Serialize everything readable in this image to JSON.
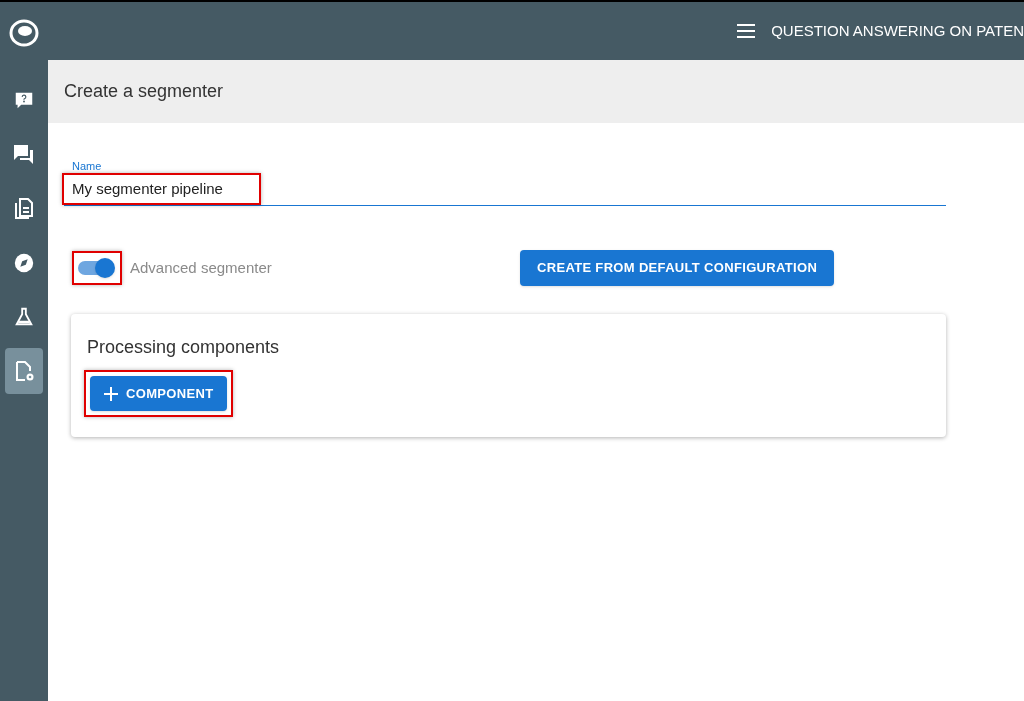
{
  "top_bar": {
    "title": "QUESTION ANSWERING ON PATEN"
  },
  "sidebar": {
    "items": [
      {
        "kind": "logo",
        "selected": false
      },
      {
        "kind": "question",
        "selected": false
      },
      {
        "kind": "chat",
        "selected": false
      },
      {
        "kind": "documents",
        "selected": false
      },
      {
        "kind": "compass",
        "selected": false
      },
      {
        "kind": "flask",
        "selected": false
      },
      {
        "kind": "file-settings",
        "selected": true
      }
    ]
  },
  "page": {
    "title": "Create a segmenter"
  },
  "name_field": {
    "label": "Name",
    "value": "My segmenter pipeline",
    "highlighted": true
  },
  "advanced_toggle": {
    "label": "Advanced segmenter",
    "on": true,
    "highlighted": true
  },
  "default_button": {
    "label": "CREATE FROM DEFAULT CONFIGURATION"
  },
  "components_card": {
    "title": "Processing components",
    "add_button": {
      "label": "COMPONENT",
      "highlighted": true
    }
  }
}
